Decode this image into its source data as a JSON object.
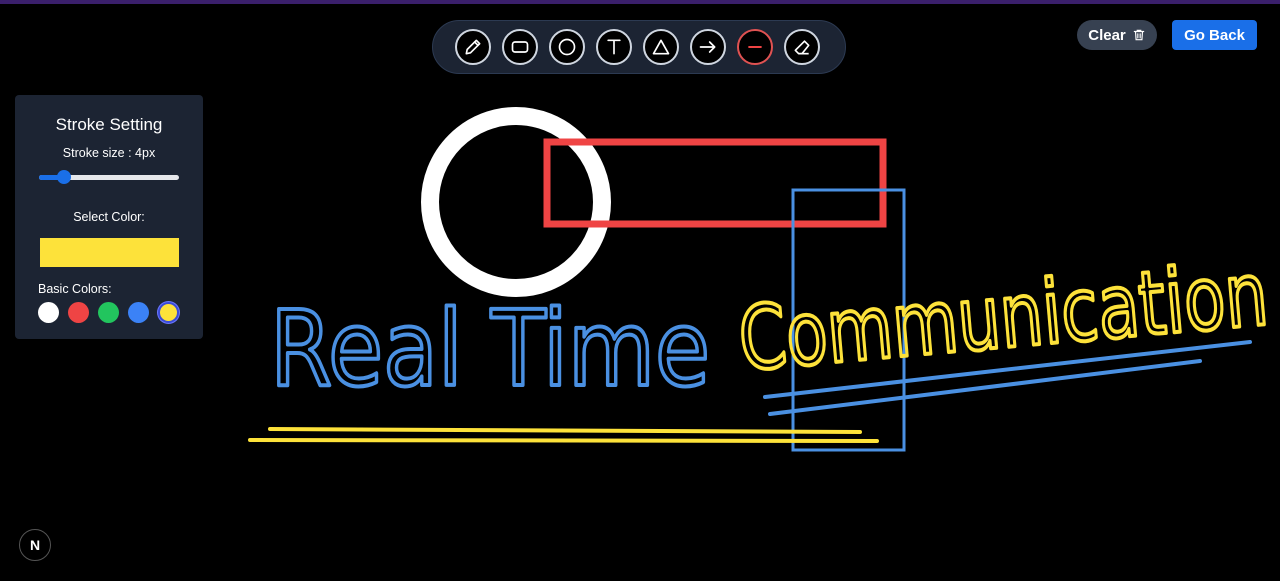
{
  "toolbar": {
    "tools": [
      {
        "name": "pencil-tool",
        "icon": "pencil-icon"
      },
      {
        "name": "rectangle-tool",
        "icon": "rectangle-icon"
      },
      {
        "name": "circle-tool",
        "icon": "circle-icon"
      },
      {
        "name": "text-tool",
        "icon": "text-icon"
      },
      {
        "name": "triangle-tool",
        "icon": "triangle-icon"
      },
      {
        "name": "arrow-tool",
        "icon": "arrow-right-icon"
      },
      {
        "name": "line-tool",
        "icon": "line-icon",
        "active": true
      },
      {
        "name": "eraser-tool",
        "icon": "eraser-icon"
      }
    ]
  },
  "header": {
    "clear_label": "Clear",
    "clear_icon": "trash-icon",
    "back_label": "Go Back"
  },
  "stroke_panel": {
    "title": "Stroke Setting",
    "size_label": "Stroke size : 4px",
    "stroke_size": 4,
    "slider_fraction": 0.18,
    "select_color_label": "Select Color:",
    "selected_color": "#fde23a",
    "basic_colors_label": "Basic Colors:",
    "basic_colors": [
      "#ffffff",
      "#ef4444",
      "#22c55e",
      "#3b82f6",
      "#fde23a"
    ],
    "selected_basic_index": 4
  },
  "canvas": {
    "text_blue": "Real Time",
    "text_yellow": "Communication",
    "colors": {
      "white": "#ffffff",
      "red": "#ef4444",
      "blue": "#4a90e2",
      "yellow": "#fde23a"
    }
  },
  "badge": {
    "label": "N"
  }
}
